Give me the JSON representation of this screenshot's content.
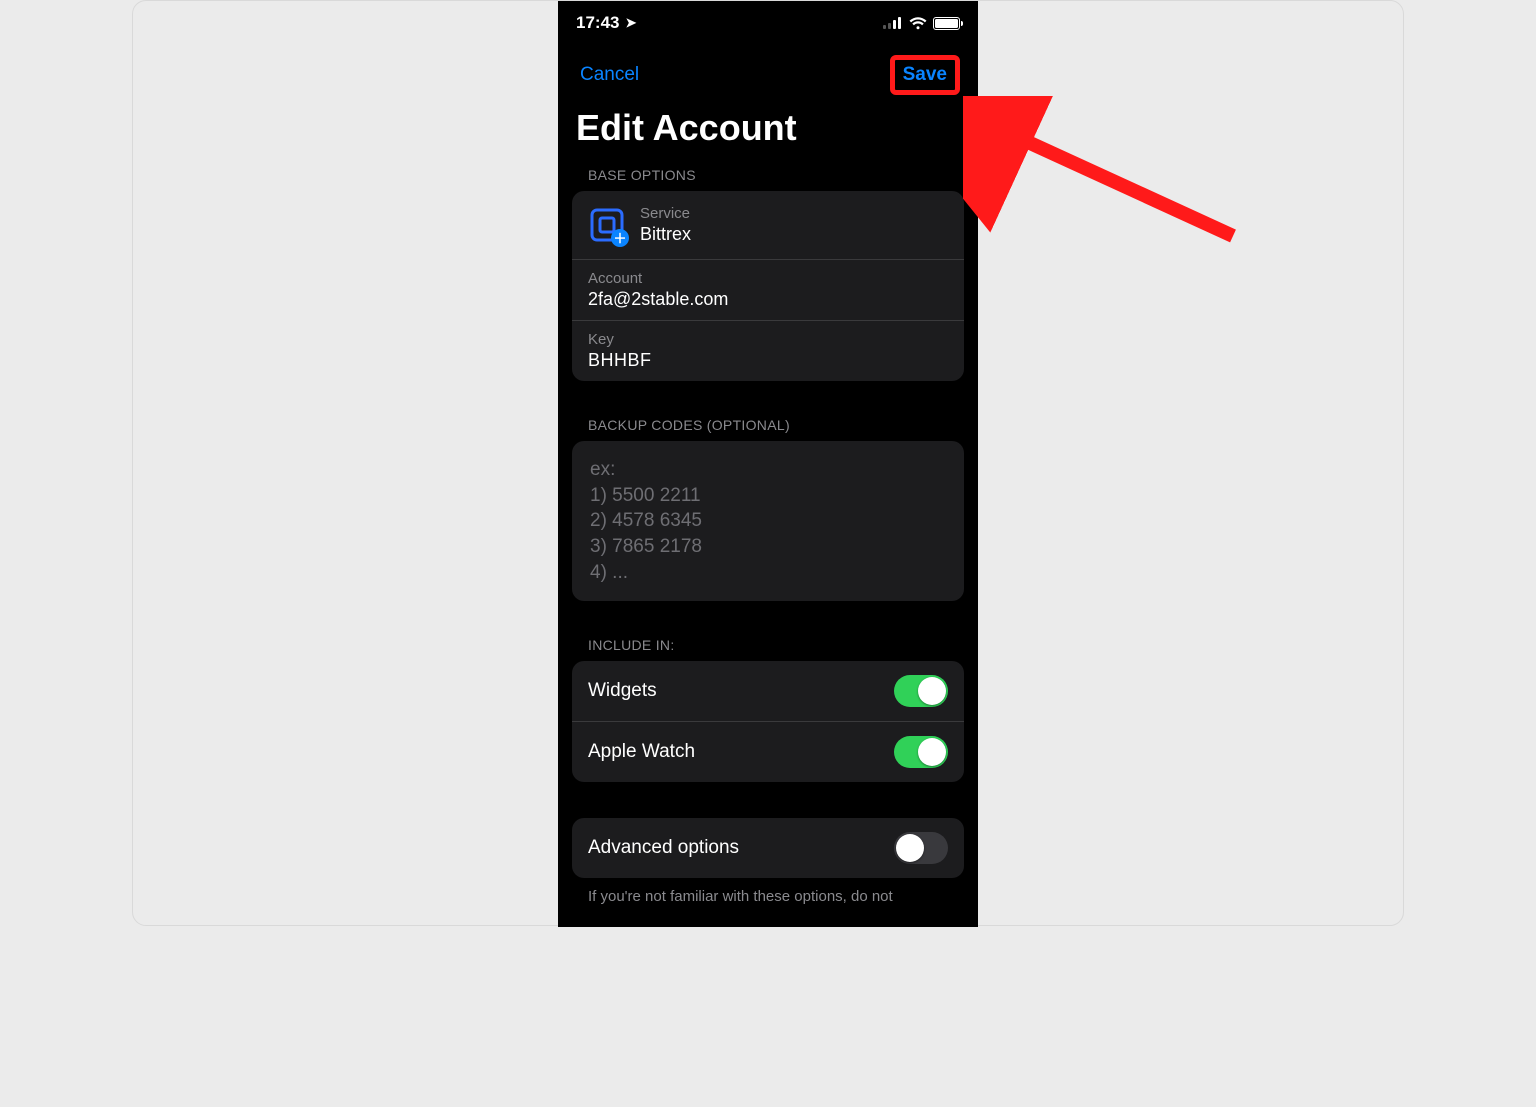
{
  "status": {
    "time": "17:43",
    "location_active": true
  },
  "nav": {
    "cancel": "Cancel",
    "save": "Save"
  },
  "title": "Edit Account",
  "sections": {
    "base_options": "BASE OPTIONS",
    "backup_codes": "BACKUP CODES (OPTIONAL)",
    "include_in": "INCLUDE IN:"
  },
  "fields": {
    "service": {
      "label": "Service",
      "value": "Bittrex"
    },
    "account": {
      "label": "Account",
      "value": "2fa@2stable.com"
    },
    "key": {
      "label": "Key",
      "value": "BHHBF"
    }
  },
  "backup_placeholder": "ex:\n1) 5500 2211\n2) 4578 6345\n3) 7865 2178\n4) ...",
  "toggles": {
    "widgets": {
      "label": "Widgets",
      "on": true
    },
    "apple_watch": {
      "label": "Apple Watch",
      "on": true
    },
    "advanced": {
      "label": "Advanced options",
      "on": false
    }
  },
  "advanced_note": "If you're not familiar with these options, do not",
  "colors": {
    "accent": "#0a84ff",
    "highlight": "#ff1a1a",
    "toggle_on": "#30d158"
  }
}
